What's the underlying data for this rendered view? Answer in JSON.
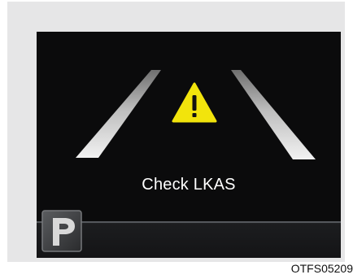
{
  "display": {
    "message": "Check LKAS",
    "warning_icon": "warning-triangle-icon",
    "gear_indicator_icon": "gear-p-icon",
    "colors": {
      "screen_bg": "#0b0b0c",
      "warning_yellow": "#f2e40c",
      "lane_gray": "#d9d9d9",
      "frame_bg": "#e6e6e7"
    }
  },
  "figure_code": "OTFS05209"
}
